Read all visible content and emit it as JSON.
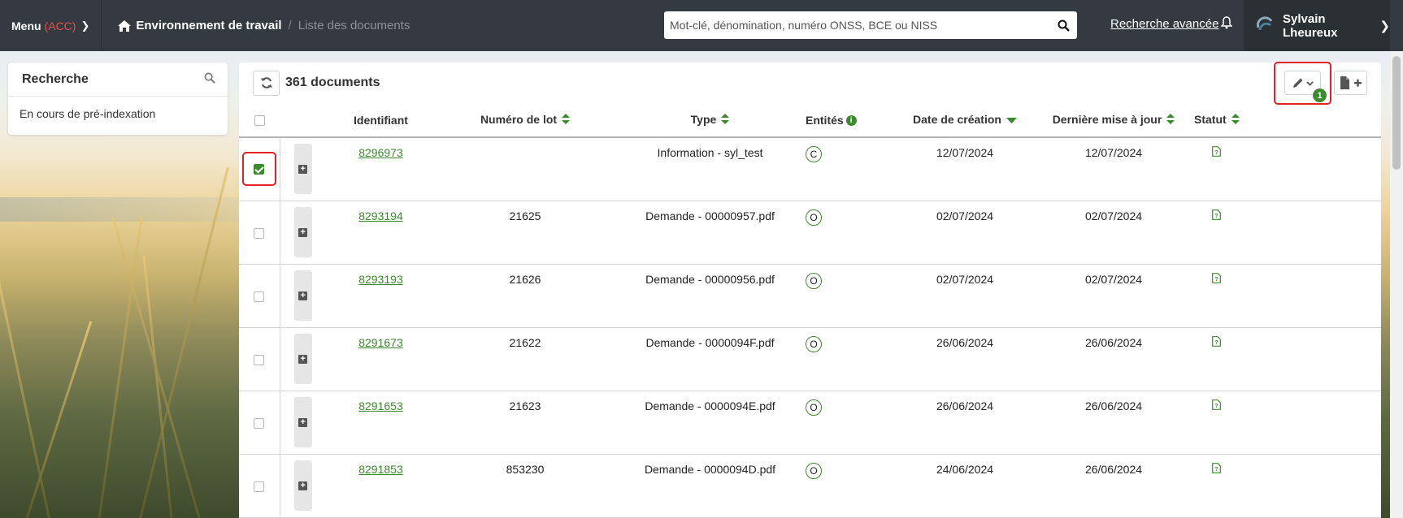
{
  "topbar": {
    "menu_label": "Menu",
    "menu_env": "(ACC)",
    "breadcrumb_home": "Environnement de travail",
    "breadcrumb_sep": "/",
    "breadcrumb_current": "Liste des documents",
    "search_placeholder": "Mot-clé, dénomination, numéro ONSS, BCE ou NISS",
    "advanced_search": "Recherche avancée",
    "user_name": "Sylvain Lheureux"
  },
  "sidebar": {
    "title": "Recherche",
    "filter": "En cours de pré-indexation"
  },
  "main": {
    "doc_count": "361 documents",
    "edit_badge_count": "1"
  },
  "table": {
    "headers": {
      "identifiant": "Identifiant",
      "lot": "Numéro de lot",
      "type": "Type",
      "entites": "Entités",
      "creation": "Date de création",
      "maj": "Dernière mise à jour",
      "statut": "Statut"
    },
    "rows": [
      {
        "id": "8296973",
        "lot": "",
        "type": "Information - syl_test",
        "entity": "C",
        "created": "12/07/2024",
        "updated": "12/07/2024",
        "checked": true
      },
      {
        "id": "8293194",
        "lot": "21625",
        "type": "Demande - 00000957.pdf",
        "entity": "O",
        "created": "02/07/2024",
        "updated": "02/07/2024",
        "checked": false
      },
      {
        "id": "8293193",
        "lot": "21626",
        "type": "Demande - 00000956.pdf",
        "entity": "O",
        "created": "02/07/2024",
        "updated": "02/07/2024",
        "checked": false
      },
      {
        "id": "8291673",
        "lot": "21622",
        "type": "Demande - 0000094F.pdf",
        "entity": "O",
        "created": "26/06/2024",
        "updated": "26/06/2024",
        "checked": false
      },
      {
        "id": "8291653",
        "lot": "21623",
        "type": "Demande - 0000094E.pdf",
        "entity": "O",
        "created": "26/06/2024",
        "updated": "26/06/2024",
        "checked": false
      },
      {
        "id": "8291853",
        "lot": "853230",
        "type": "Demande - 0000094D.pdf",
        "entity": "O",
        "created": "24/06/2024",
        "updated": "26/06/2024",
        "checked": false
      }
    ]
  },
  "colors": {
    "accent": "#3c8a2e",
    "topbar": "#343a40",
    "highlight": "#e02424"
  }
}
